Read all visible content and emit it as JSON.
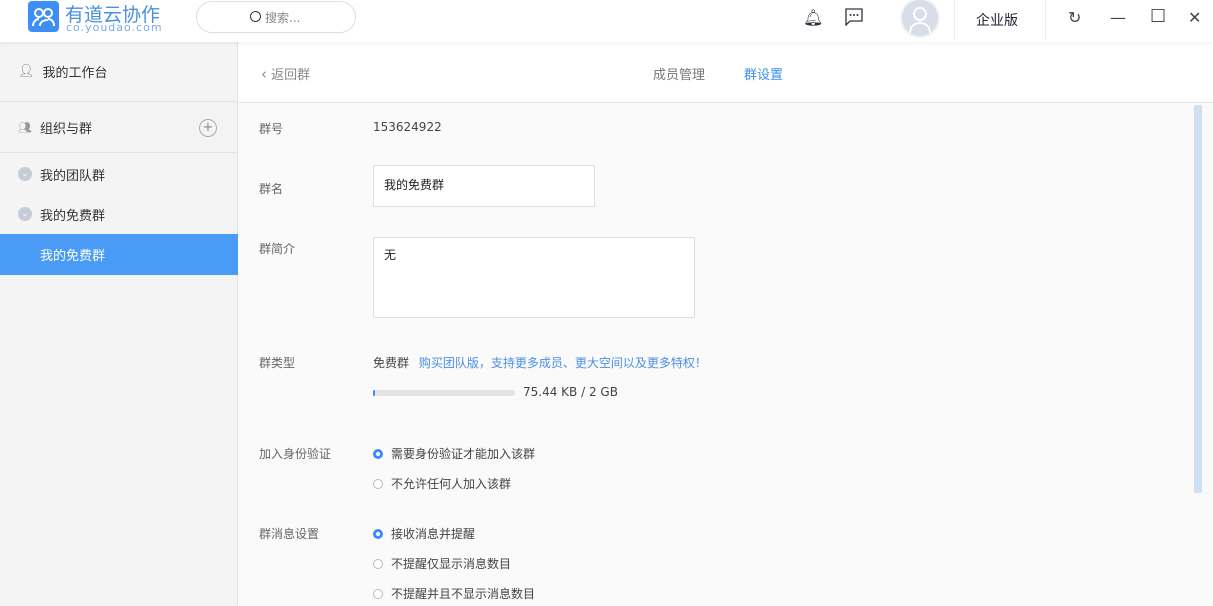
{
  "app": {
    "brand": "有道云协作",
    "domain": "co.youdao.com",
    "search_placeholder": "搜索...",
    "edition": "企业版"
  },
  "sidebar": {
    "workbench": "我的工作台",
    "org": "组织与群",
    "groups": [
      {
        "label": "我的团队群"
      },
      {
        "label": "我的免费群"
      }
    ],
    "selected": "我的免费群"
  },
  "header": {
    "back": "返回群",
    "tabs": [
      {
        "label": "成员管理"
      },
      {
        "label": "群设置"
      }
    ],
    "active_tab": "群设置"
  },
  "settings": {
    "group_id_label": "群号",
    "group_id": "153624922",
    "name_label": "群名",
    "name": "我的免费群",
    "intro_label": "群简介",
    "intro": "无",
    "type_label": "群类型",
    "type": "免费群",
    "upgrade_link": "购买团队版，支持更多成员、更大空间以及更多特权！",
    "storage": {
      "text": "75.44 KB / 2 GB",
      "used_fraction": 4e-05
    },
    "verify_label": "加入身份验证",
    "verify_options": [
      "需要身份验证才能加入该群",
      "不允许任何人加入该群"
    ],
    "verify_selected": 0,
    "msg_label": "群消息设置",
    "msg_options": [
      "接收消息并提醒",
      "不提醒仅显示消息数目",
      "不提醒并且不显示消息数目"
    ],
    "msg_selected": 0
  },
  "colors": {
    "accent": "#3d8ef7",
    "selected_bg": "#4a9bf5"
  }
}
